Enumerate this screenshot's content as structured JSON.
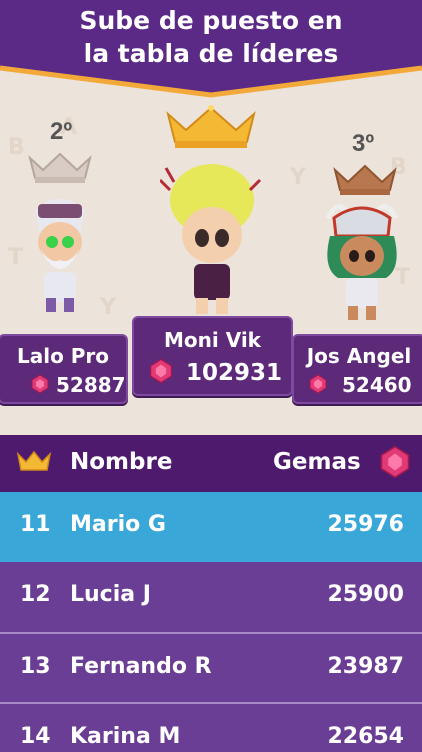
{
  "banner": {
    "line1": "Sube de puesto en",
    "line2": "la tabla de líderes"
  },
  "podium": {
    "first": {
      "rank_label": "",
      "name": "Moni Vik",
      "gems": "102931"
    },
    "second": {
      "rank_label": "2º",
      "name": "Lalo Pro",
      "gems": "52887"
    },
    "third": {
      "rank_label": "3º",
      "name": "Jos Angel",
      "gems": "52460"
    }
  },
  "table": {
    "header": {
      "name": "Nombre",
      "gems": "Gemas"
    },
    "rows": [
      {
        "rank": "11",
        "name": "Mario G",
        "gems": "25976"
      },
      {
        "rank": "12",
        "name": "Lucia J",
        "gems": "25900"
      },
      {
        "rank": "13",
        "name": "Fernando R",
        "gems": "23987"
      },
      {
        "rank": "14",
        "name": "Karina M",
        "gems": "22654"
      }
    ]
  },
  "colors": {
    "banner": "#5a2a86",
    "banner_border": "#f3a93a",
    "table_header": "#4e1a6e",
    "highlight_row": "#39a8d8",
    "row": "#6b3e96",
    "gold": "#f4b934",
    "gem": "#e23a76"
  },
  "icons": [
    "crown-gold-icon",
    "crown-silver-icon",
    "crown-bronze-icon",
    "gem-icon",
    "crown-small-icon"
  ]
}
